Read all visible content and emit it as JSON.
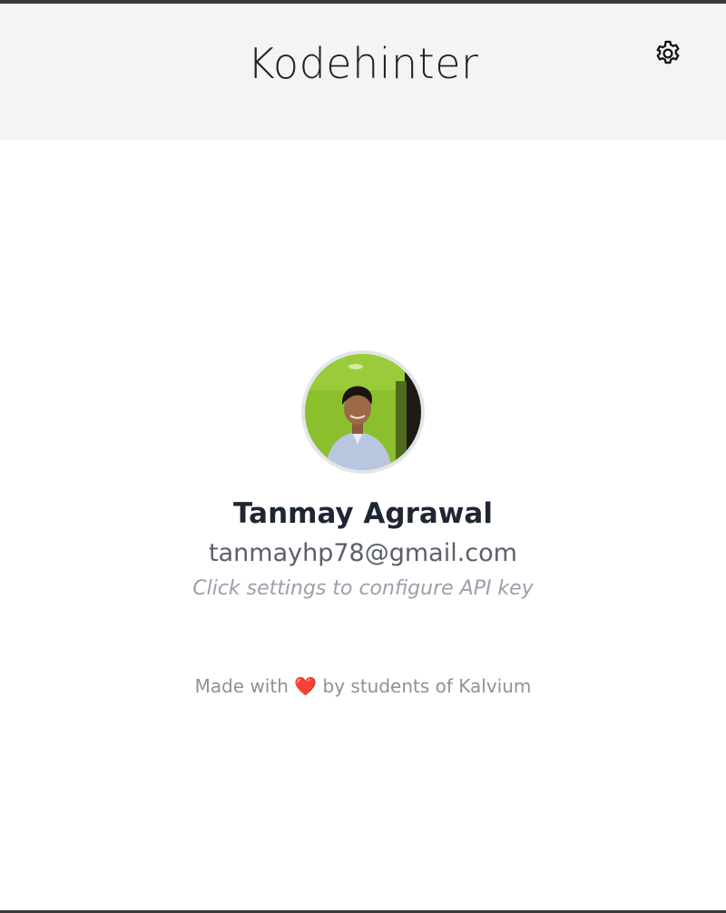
{
  "header": {
    "title": "Kodehinter",
    "settings_icon": "gear-icon"
  },
  "profile": {
    "avatar_alt": "user-photo",
    "name": "Tanmay Agrawal",
    "email": "tanmayhp78@gmail.com",
    "hint": "Click settings to configure API key"
  },
  "footer": {
    "prefix": "Made with",
    "heart": "❤️",
    "suffix": "by students of Kalvium"
  },
  "colors": {
    "header_bg": "#f4f4f4",
    "heart": "#e0352b"
  }
}
